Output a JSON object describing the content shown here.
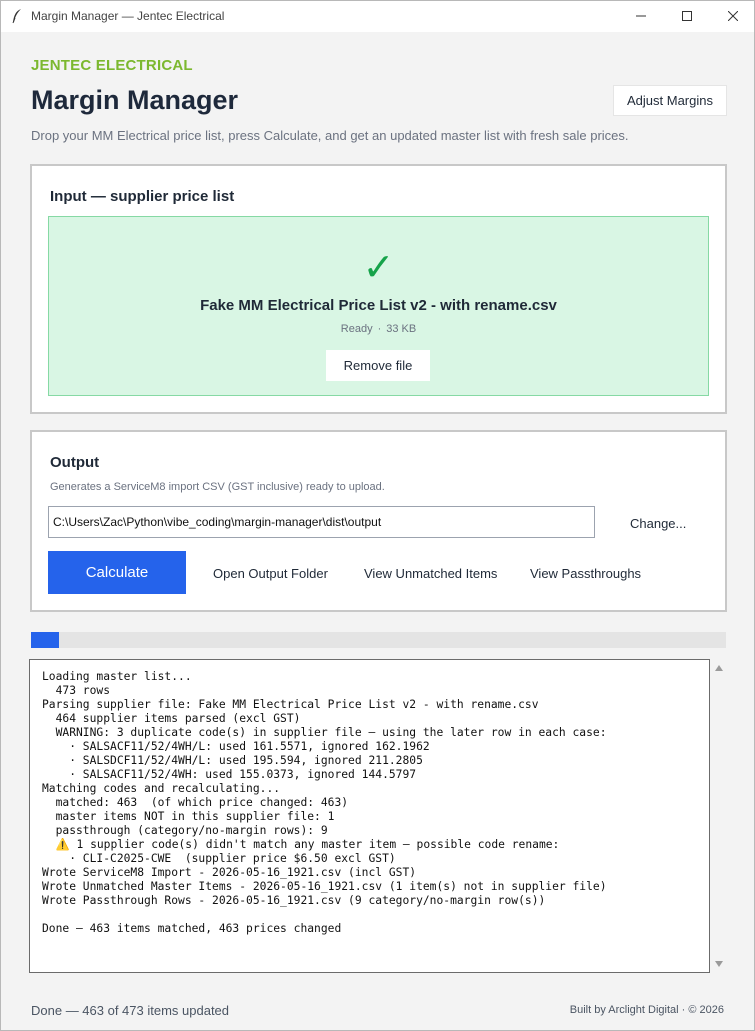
{
  "window": {
    "title": "Margin Manager — Jentec Electrical",
    "icons": [
      "feather-icon",
      "minimize-icon",
      "maximize-icon",
      "close-icon"
    ]
  },
  "header": {
    "brand": "JENTEC ELECTRICAL",
    "title": "Margin Manager",
    "adjust_label": "Adjust Margins",
    "subtitle": "Drop your MM Electrical price list, press Calculate, and get an updated master list with fresh sale prices."
  },
  "input_card": {
    "title": "Input — supplier price list",
    "filename": "Fake MM Electrical Price List v2 - with rename.csv",
    "status": "Ready",
    "separator": "·",
    "size": "33 KB",
    "remove_label": "Remove file"
  },
  "output_card": {
    "title": "Output",
    "description": "Generates a ServiceM8 import CSV (GST inclusive) ready to upload.",
    "path": "C:\\Users\\Zac\\Python\\vibe_coding\\margin-manager\\dist\\output",
    "change_label": "Change...",
    "calculate_label": "Calculate",
    "open_folder_label": "Open Output Folder",
    "unmatched_label": "View Unmatched Items",
    "passthroughs_label": "View Passthroughs"
  },
  "progress": {
    "percent": 4
  },
  "log": {
    "lines": [
      "Loading master list...",
      "  473 rows",
      "Parsing supplier file: Fake MM Electrical Price List v2 - with rename.csv",
      "  464 supplier items parsed (excl GST)",
      "  WARNING: 3 duplicate code(s) in supplier file — using the later row in each case:",
      "    · SALSACF11/52/4WH/L: used 161.5571, ignored 162.1962",
      "    · SALSDCF11/52/4WH/L: used 195.594, ignored 211.2805",
      "    · SALSACF11/52/4WH: used 155.0373, ignored 144.5797",
      "Matching codes and recalculating...",
      "  matched: 463  (of which price changed: 463)",
      "  master items NOT in this supplier file: 1",
      "  passthrough (category/no-margin rows): 9",
      "  ⚠️ 1 supplier code(s) didn't match any master item — possible code rename:",
      "    · CLI-C2025-CWE  (supplier price $6.50 excl GST)",
      "Wrote ServiceM8 Import - 2026-05-16_1921.csv (incl GST)",
      "Wrote Unmatched Master Items - 2026-05-16_1921.csv (1 item(s) not in supplier file)",
      "Wrote Passthrough Rows - 2026-05-16_1921.csv (9 category/no-margin row(s))",
      "",
      "Done — 463 items matched, 463 prices changed"
    ]
  },
  "footer": {
    "status": "Done — 463 of 473 items updated",
    "credit": "Built by Arclight Digital  ·  © 2026"
  },
  "colors": {
    "brand": "#7cb82f",
    "accent": "#2563eb",
    "success_bg": "#d9f6e4",
    "success_border": "#86d9a4",
    "check": "#16a34a"
  }
}
